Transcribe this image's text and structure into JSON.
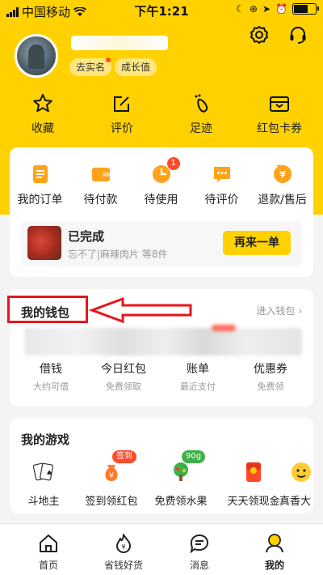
{
  "status_bar": {
    "carrier": "中国移动",
    "time": "下午1:21"
  },
  "header": {
    "tags": [
      "去实名",
      "成长值"
    ],
    "quick_links": [
      "收藏",
      "评价",
      "足迹",
      "红包卡券"
    ]
  },
  "orders": {
    "items": [
      {
        "label": "我的订单",
        "icon": "order-icon"
      },
      {
        "label": "待付款",
        "icon": "wallet-icon"
      },
      {
        "label": "待使用",
        "icon": "clock-icon",
        "badge": "1"
      },
      {
        "label": "待评价",
        "icon": "chat-icon"
      },
      {
        "label": "退款/售后",
        "icon": "refund-icon"
      }
    ],
    "completed": {
      "title": "已完成",
      "subtitle": "忘不了|麻辣肉片 等8件",
      "button": "再来一单"
    }
  },
  "wallet": {
    "title": "我的钱包",
    "enter_link": "进入钱包 ›",
    "items": [
      {
        "label": "借钱",
        "sub": "大约可借"
      },
      {
        "label": "今日红包",
        "sub": "免费领取"
      },
      {
        "label": "账单",
        "sub": "最近支付"
      },
      {
        "label": "优惠券",
        "sub": "免费领"
      }
    ]
  },
  "games": {
    "title": "我的游戏",
    "items": [
      {
        "label": "斗地主",
        "badge": ""
      },
      {
        "label": "签到领红包",
        "badge": "签到"
      },
      {
        "label": "免费领水果",
        "badge": "90g"
      },
      {
        "label": "天天领现金",
        "badge": ""
      },
      {
        "label": "真香大",
        "badge": ""
      }
    ]
  },
  "tabbar": {
    "items": [
      {
        "label": "首页",
        "icon": "home-icon"
      },
      {
        "label": "省钱好货",
        "icon": "flame-icon"
      },
      {
        "label": "消息",
        "icon": "message-icon"
      },
      {
        "label": "我的",
        "icon": "profile-icon"
      }
    ],
    "active": "我的"
  },
  "colors": {
    "brand_yellow": "#ffd100",
    "badge_red": "#ff4a2a",
    "annotation_red": "#e8141c"
  }
}
